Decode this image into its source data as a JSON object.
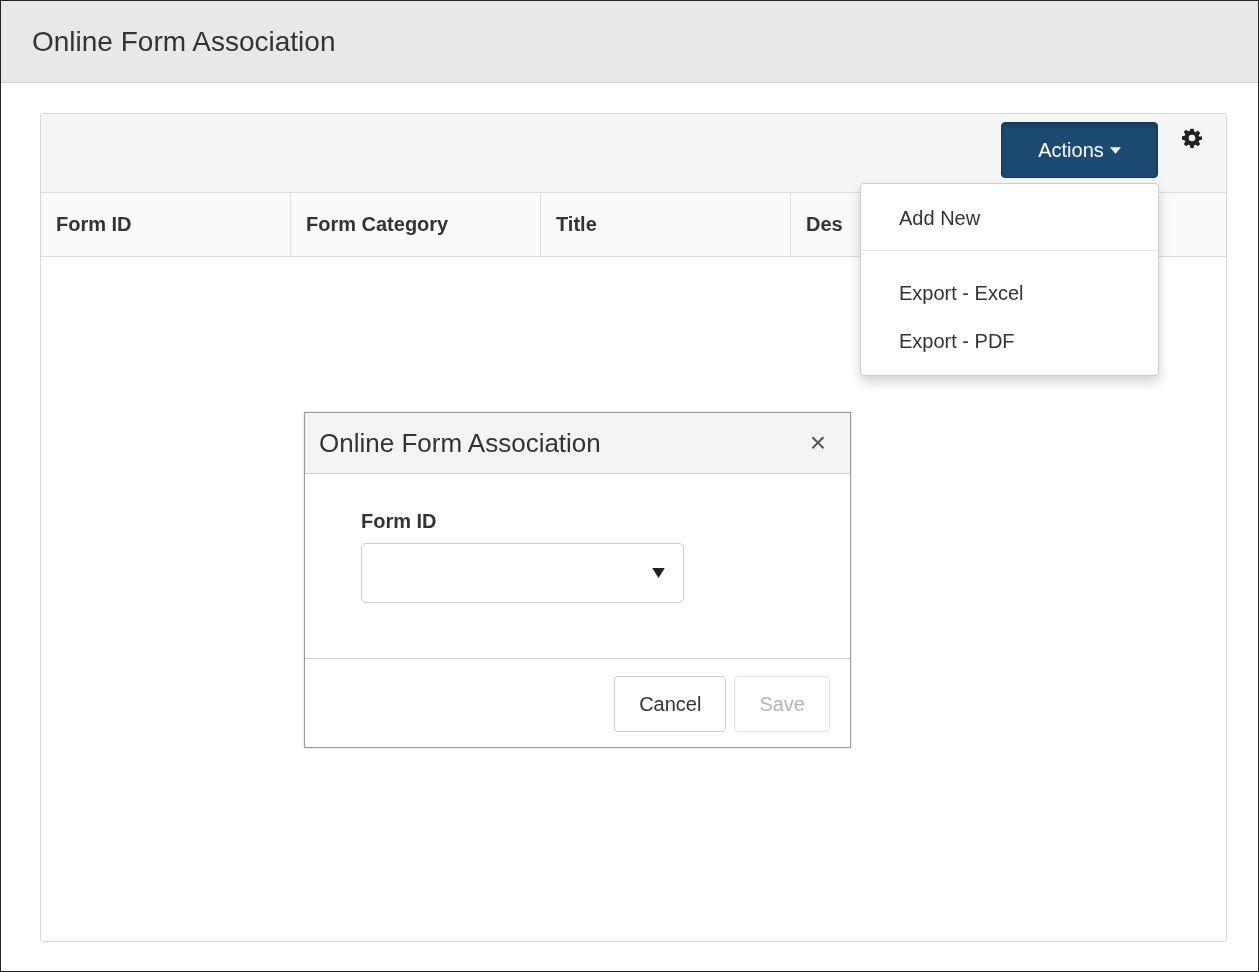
{
  "page": {
    "title": "Online Form Association"
  },
  "toolbar": {
    "actions_button": {
      "label": "Actions",
      "expanded": true
    }
  },
  "table": {
    "columns": [
      "Form ID",
      "Form Category",
      "Title",
      "Des"
    ]
  },
  "actions_menu": {
    "items": [
      {
        "kind": "item",
        "label": "Add New"
      },
      {
        "kind": "divider"
      },
      {
        "kind": "item",
        "label": "Export - Excel"
      },
      {
        "kind": "item",
        "label": "Export - PDF"
      }
    ]
  },
  "dialog": {
    "title": "Online Form Association",
    "close": "×",
    "field": {
      "label": "Form ID"
    },
    "buttons": [
      {
        "label": "Cancel",
        "disabled": false
      },
      {
        "label": "Save",
        "disabled": true
      }
    ]
  }
}
